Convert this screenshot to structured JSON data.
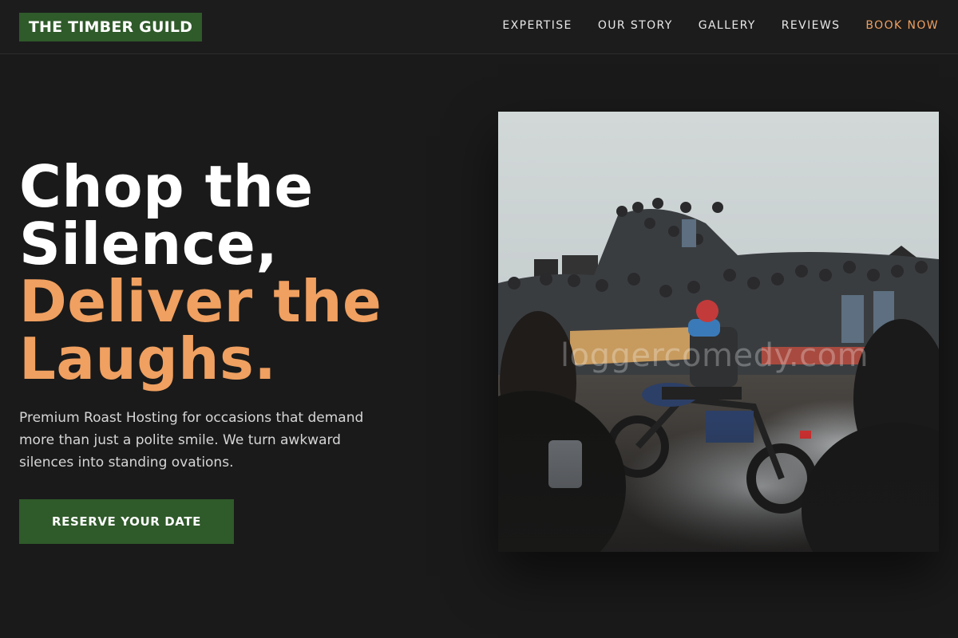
{
  "brand": {
    "logo_text": "THE TIMBER GUILD"
  },
  "nav": {
    "links": [
      {
        "label": "EXPERTISE"
      },
      {
        "label": "OUR STORY"
      },
      {
        "label": "GALLERY"
      },
      {
        "label": "REVIEWS"
      },
      {
        "label": "BOOK NOW"
      }
    ]
  },
  "hero": {
    "headline_lines": [
      "Chop the",
      "Silence,",
      "Deliver the",
      "Laughs."
    ],
    "subtext": "Premium Roast Hosting for occasions that demand more than just a polite smile. We turn awkward silences into standing ovations.",
    "cta_label": "RESERVE YOUR DATE",
    "photo_watermark": "loggercomedy.com"
  },
  "colors": {
    "background": "#1a1a1a",
    "brand_green": "#2f5a2a",
    "accent_orange": "#f0a060",
    "text_light": "#d6d6d6"
  }
}
